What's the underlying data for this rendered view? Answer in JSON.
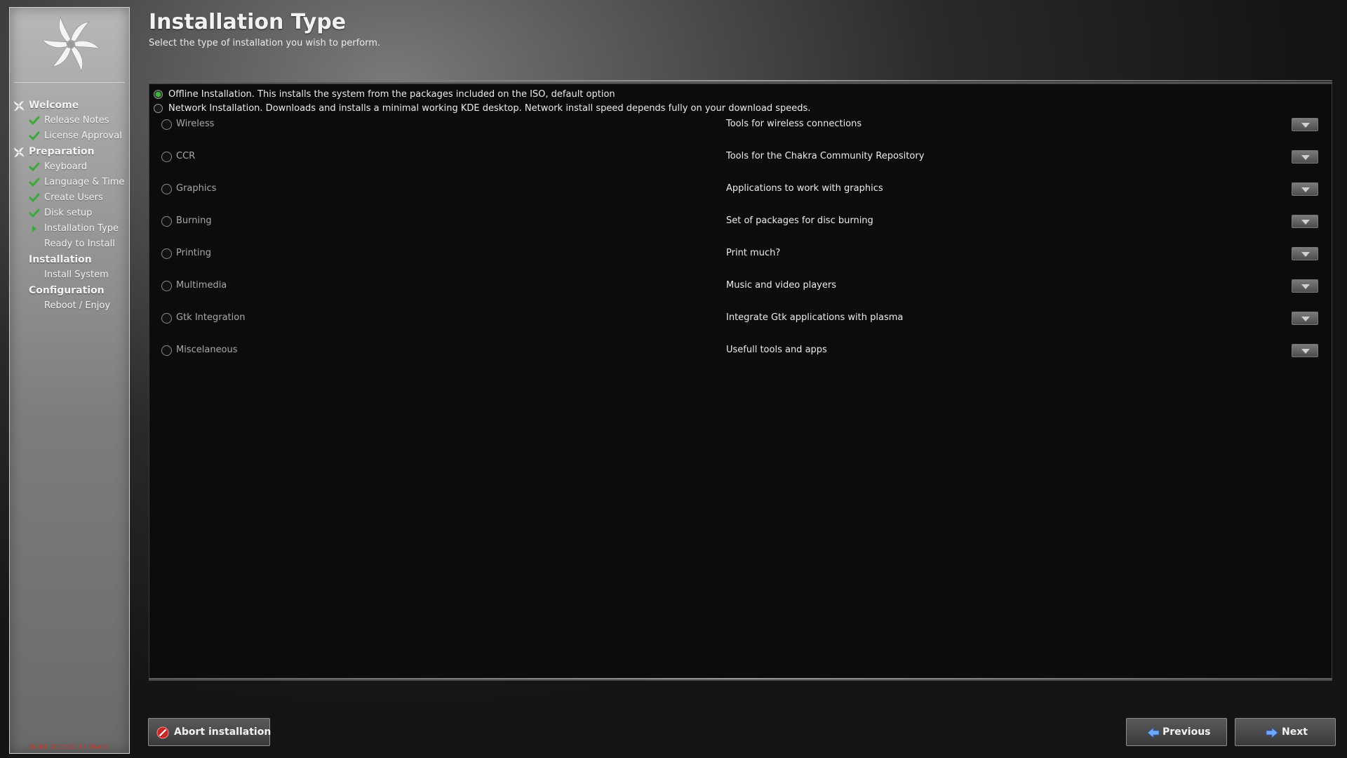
{
  "sidebar": {
    "steps": [
      {
        "label": "Welcome",
        "kind": "section",
        "icon": "chakra-icon"
      },
      {
        "label": "Release Notes",
        "kind": "item",
        "status": "done"
      },
      {
        "label": "License Approval",
        "kind": "item",
        "status": "done"
      },
      {
        "label": "Preparation",
        "kind": "section",
        "icon": "chakra-icon"
      },
      {
        "label": "Keyboard",
        "kind": "item",
        "status": "done"
      },
      {
        "label": "Language & Time",
        "kind": "item",
        "status": "done"
      },
      {
        "label": "Create Users",
        "kind": "item",
        "status": "done"
      },
      {
        "label": "Disk setup",
        "kind": "item",
        "status": "done"
      },
      {
        "label": "Installation Type",
        "kind": "item",
        "status": "current"
      },
      {
        "label": "Ready to Install",
        "kind": "item",
        "status": "pending"
      },
      {
        "label": "Installation",
        "kind": "section"
      },
      {
        "label": "Install System",
        "kind": "item",
        "status": "pending"
      },
      {
        "label": "Configuration",
        "kind": "section"
      },
      {
        "label": "Reboot / Enjoy",
        "kind": "item",
        "status": "pending"
      }
    ],
    "build": "Build: 2013.02.17 (Benz)"
  },
  "header": {
    "title": "Installation Type",
    "subtitle": "Select the type of installation you wish to perform."
  },
  "install_modes": [
    {
      "label": "Offline Installation.  This installs the system from the packages included on the ISO, default option",
      "checked": true
    },
    {
      "label": "Network Installation.  Downloads and installs a minimal working KDE desktop.  Network install speed depends fully on your download speeds.",
      "checked": false
    }
  ],
  "groups": [
    {
      "name": "Wireless",
      "desc": "Tools for wireless connections"
    },
    {
      "name": "CCR",
      "desc": "Tools for the Chakra Community Repository"
    },
    {
      "name": "Graphics",
      "desc": "Applications to work with graphics"
    },
    {
      "name": "Burning",
      "desc": "Set of packages for disc burning"
    },
    {
      "name": "Printing",
      "desc": "Print much?"
    },
    {
      "name": "Multimedia",
      "desc": "Music and video players"
    },
    {
      "name": "Gtk Integration",
      "desc": "Integrate Gtk applications with plasma"
    },
    {
      "name": "Miscelaneous",
      "desc": "Usefull tools and apps"
    }
  ],
  "buttons": {
    "abort": "Abort installation",
    "previous": "Previous",
    "next": "Next"
  },
  "colors": {
    "radio_checked": "#3fb43f",
    "check_done": "#3aa83a",
    "build_text": "#c0392b"
  }
}
